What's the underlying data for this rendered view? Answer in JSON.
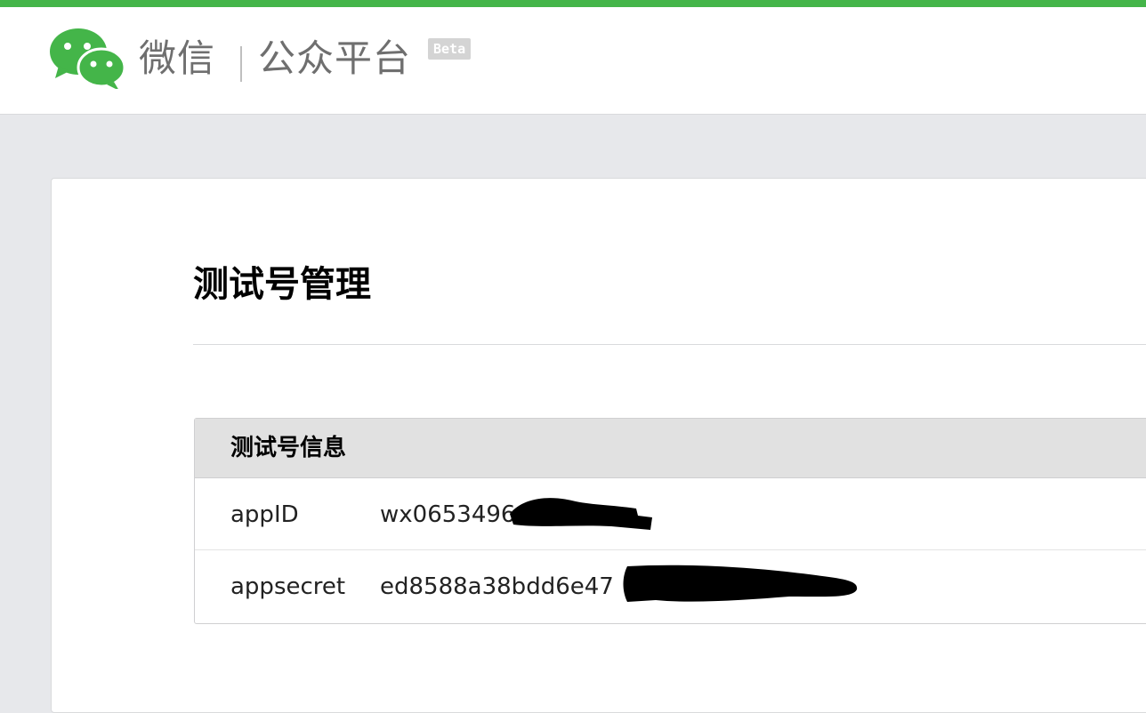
{
  "header": {
    "brand": "微信",
    "platform": "公众平台",
    "badge": "Beta"
  },
  "colors": {
    "accent": "#44b549",
    "page_bg": "#e7e8eb",
    "panel_header_bg": "#e1e1e1",
    "redaction": "#000000"
  },
  "page": {
    "title": "测试号管理"
  },
  "info_panel": {
    "title": "测试号信息",
    "rows": [
      {
        "label": "appID",
        "value": "wx0653496"
      },
      {
        "label": "appsecret",
        "value": "ed8588a38bdd6e47"
      }
    ]
  },
  "icons": [
    "wechat-logo-icon"
  ]
}
